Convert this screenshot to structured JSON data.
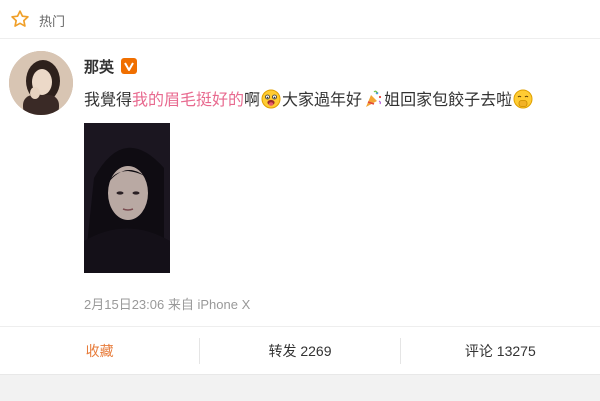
{
  "header": {
    "title": "热门",
    "icon": "star-icon"
  },
  "post": {
    "author": "那英",
    "verified_icon": "vip-v-badge-icon",
    "text": {
      "part1": "我覺得",
      "highlight": "我的眉毛挺好的",
      "part2": "啊",
      "part3": "大家過年好",
      "part4": "姐回家包餃子去啦"
    },
    "timestamp": "2月15日23:06",
    "source_prefix": "来自",
    "source": "iPhone X"
  },
  "actions": {
    "favorite": "收藏",
    "repost_label": "转发",
    "repost_count": "2269",
    "comment_label": "评论",
    "comment_count": "13275"
  },
  "colors": {
    "highlight_text": "#e86a8f",
    "favorite_text": "#e77c3b",
    "verified_badge": "#f06f00",
    "star_icon": "#f0a02a"
  }
}
